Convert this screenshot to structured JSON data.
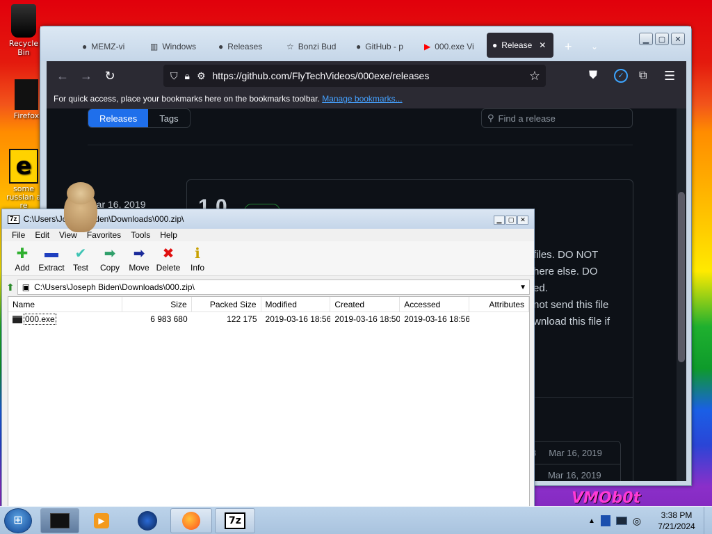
{
  "desktop": {
    "icons": [
      {
        "label": "Recycle Bin"
      },
      {
        "label": "Firefox"
      },
      {
        "label": "some russian a re"
      }
    ],
    "watermark": "VMOb0t"
  },
  "firefox": {
    "tabs": [
      {
        "label": "MEMZ-vi"
      },
      {
        "label": "Windows"
      },
      {
        "label": "Releases"
      },
      {
        "label": "Bonzi Bud"
      },
      {
        "label": "GitHub - p"
      },
      {
        "label": "000.exe Vi"
      },
      {
        "label": "Release"
      }
    ],
    "url": "https://github.com/FlyTechVideos/000exe/releases",
    "bookmarks_text": "For quick access, place your bookmarks here on the bookmarks toolbar.",
    "bookmarks_link": "Manage bookmarks...",
    "page": {
      "tabs": [
        "Releases",
        "Tags"
      ],
      "search_placeholder": "Find a release",
      "release_date": "Mar 16, 2019",
      "release_title": "1.0",
      "body_lines": [
        "files. DO NOT",
        "here else. DO",
        "ed.",
        "not send this file",
        "wnload this file if"
      ],
      "asset_num": "8",
      "asset_dates": [
        "Mar 16, 2019",
        "Mar 16, 2019"
      ]
    }
  },
  "sevenzip": {
    "title": "C:\\Users\\Joseph Biden\\Downloads\\000.zip\\",
    "menu": [
      "File",
      "Edit",
      "View",
      "Favorites",
      "Tools",
      "Help"
    ],
    "toolbar": [
      {
        "label": "Add",
        "icon": "plus-icon",
        "color": "#2fb02f"
      },
      {
        "label": "Extract",
        "icon": "minus-icon",
        "color": "#1f3fbf"
      },
      {
        "label": "Test",
        "icon": "check-icon",
        "color": "#3fc4b4"
      },
      {
        "label": "Copy",
        "icon": "copy-arrow-icon",
        "color": "#2f9f6a"
      },
      {
        "label": "Move",
        "icon": "move-arrow-icon",
        "color": "#1a2a9a"
      },
      {
        "label": "Delete",
        "icon": "x-icon",
        "color": "#e01010"
      },
      {
        "label": "Info",
        "icon": "info-icon",
        "color": "#c8a000"
      }
    ],
    "address": "C:\\Users\\Joseph Biden\\Downloads\\000.zip\\",
    "columns": [
      "Name",
      "Size",
      "Packed Size",
      "Modified",
      "Created",
      "Accessed",
      "Attributes"
    ],
    "files": [
      {
        "name": "000.exe",
        "size": "6 983 680",
        "packed": "122 175",
        "modified": "2019-03-16 18:56",
        "created": "2019-03-16 18:50",
        "accessed": "2019-03-16 18:56",
        "attributes": ""
      }
    ]
  },
  "taskbar": {
    "time": "3:38 PM",
    "date": "7/21/2024"
  }
}
